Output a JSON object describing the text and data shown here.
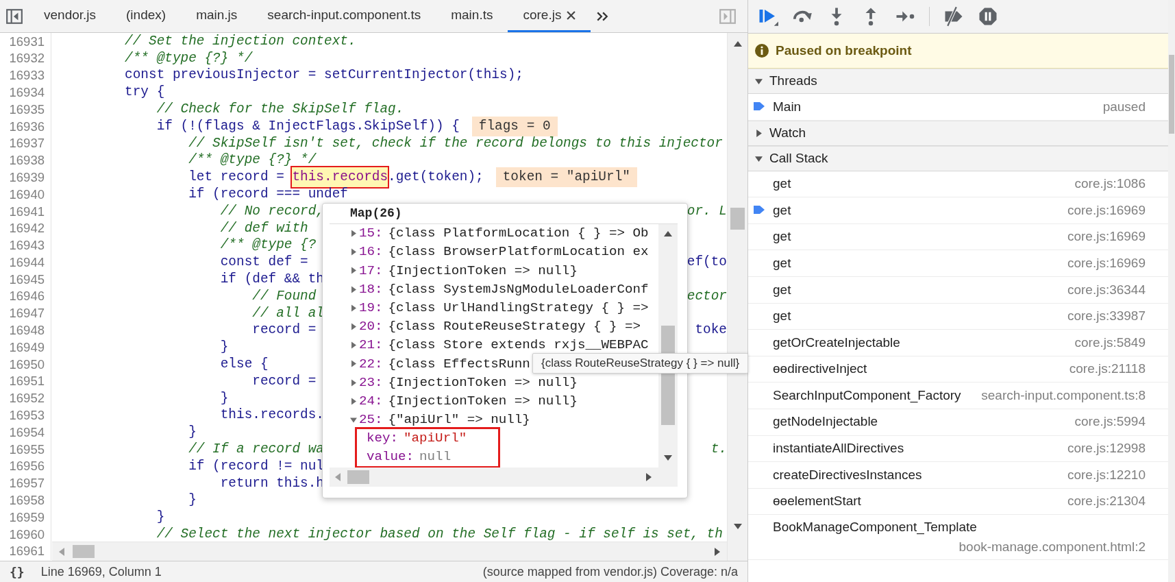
{
  "editor_tabs": [
    {
      "label": "vendor.js",
      "selected": false,
      "closable": false
    },
    {
      "label": "(index)",
      "selected": false,
      "closable": false
    },
    {
      "label": "main.js",
      "selected": false,
      "closable": false
    },
    {
      "label": "search-input.component.ts",
      "selected": false,
      "closable": false
    },
    {
      "label": "main.ts",
      "selected": false,
      "closable": false
    },
    {
      "label": "core.js",
      "selected": true,
      "closable": true
    }
  ],
  "code": {
    "lines": [
      {
        "number": "16931",
        "kind": "comment",
        "text": "        // Set the injection context."
      },
      {
        "number": "16932",
        "kind": "comment",
        "text": "        /** @type {?} */"
      },
      {
        "number": "16933",
        "kind": "code",
        "text": "        const previousInjector = setCurrentInjector(this);"
      },
      {
        "number": "16934",
        "kind": "code",
        "text": "        try {"
      },
      {
        "number": "16935",
        "kind": "comment",
        "text": "            // Check for the SkipSelf flag."
      },
      {
        "number": "16936",
        "kind": "code",
        "text": "            if (!(flags & InjectFlags.SkipSelf)) {",
        "value": "flags = 0"
      },
      {
        "number": "16937",
        "kind": "comment",
        "text": "                // SkipSelf isn't set, check if the record belongs to this injector"
      },
      {
        "number": "16938",
        "kind": "comment",
        "text": "                /** @type {?} */"
      },
      {
        "number": "16939",
        "kind": "code",
        "text": "                let record = ",
        "highlight": "this.records",
        "after": ".get(token);",
        "value": "token = \"apiUrl\""
      },
      {
        "number": "16940",
        "kind": "code",
        "text": "                if (record === undef"
      },
      {
        "number": "16941",
        "kind": "comment",
        "text": "                    // No record,",
        "tail": "or. L"
      },
      {
        "number": "16942",
        "kind": "comment",
        "text": "                    // def with"
      },
      {
        "number": "16943",
        "kind": "comment",
        "text": "                    /** @type {?"
      },
      {
        "number": "16944",
        "kind": "code",
        "text": "                    const def =",
        "tail": "ef(to"
      },
      {
        "number": "16945",
        "kind": "code",
        "text": "                    if (def && th"
      },
      {
        "number": "16946",
        "kind": "comment",
        "text": "                        // Found",
        "tail": "ector"
      },
      {
        "number": "16947",
        "kind": "comment",
        "text": "                        // all al"
      },
      {
        "number": "16948",
        "kind": "code",
        "text": "                        record =",
        "tail": "toke"
      },
      {
        "number": "16949",
        "kind": "code",
        "text": "                    }"
      },
      {
        "number": "16950",
        "kind": "code",
        "text": "                    else {"
      },
      {
        "number": "16951",
        "kind": "code",
        "text": "                        record ="
      },
      {
        "number": "16952",
        "kind": "code",
        "text": "                    }"
      },
      {
        "number": "16953",
        "kind": "code",
        "text": "                    this.records."
      },
      {
        "number": "16954",
        "kind": "code",
        "text": "                }"
      },
      {
        "number": "16955",
        "kind": "comment",
        "text": "                // If a record wa",
        "tail": "t."
      },
      {
        "number": "16956",
        "kind": "code",
        "text": "                if (record != nul"
      },
      {
        "number": "16957",
        "kind": "code",
        "text": "                    return this.h"
      },
      {
        "number": "16958",
        "kind": "code",
        "text": "                }"
      },
      {
        "number": "16959",
        "kind": "code",
        "text": "            }"
      },
      {
        "number": "16960",
        "kind": "comment",
        "text": "            // Select the next injector based on the Self flag - if self is set, th"
      },
      {
        "number": "16961",
        "kind": "code"
      }
    ]
  },
  "popup": {
    "title": "Map(26)",
    "entries": [
      {
        "key": "15:",
        "text": "{class PlatformLocation { } => Ob",
        "expanded": false
      },
      {
        "key": "16:",
        "text": "{class BrowserPlatformLocation ex",
        "expanded": false
      },
      {
        "key": "17:",
        "text": "{InjectionToken => null}",
        "expanded": false
      },
      {
        "key": "18:",
        "text": "{class SystemJsNgModuleLoaderConf",
        "expanded": false
      },
      {
        "key": "19:",
        "text": "{class UrlHandlingStrategy { } =>",
        "expanded": false
      },
      {
        "key": "20:",
        "text": "{class RouteReuseStrategy { } =>",
        "expanded": false
      },
      {
        "key": "21:",
        "text": "{class Store extends rxjs__WEBPAC",
        "expanded": false
      },
      {
        "key": "22:",
        "text": "{class EffectsRunn",
        "expanded": false
      },
      {
        "key": "23:",
        "text": "{InjectionToken => null}",
        "expanded": false
      },
      {
        "key": "24:",
        "text": "{InjectionToken => null}",
        "expanded": false
      },
      {
        "key": "25:",
        "text": "{\"apiUrl\" => null}",
        "expanded": true,
        "children": [
          {
            "key": "key:",
            "value": "\"apiUrl\"",
            "kind": "string"
          },
          {
            "key": "value:",
            "value": "null",
            "kind": "null"
          }
        ]
      }
    ]
  },
  "tooltip": {
    "text": "{class RouteReuseStrategy { } => null}"
  },
  "debugger": {
    "paused_message": "Paused on breakpoint",
    "sections": [
      {
        "title": "Threads",
        "expanded": true,
        "items": [
          {
            "name": "Main",
            "location": "paused",
            "current": true
          }
        ]
      },
      {
        "title": "Watch",
        "expanded": false
      },
      {
        "title": "Call Stack",
        "expanded": true,
        "items": [
          {
            "name": "get",
            "location": "core.js:1086",
            "current": false
          },
          {
            "name": "get",
            "location": "core.js:16969",
            "current": true
          },
          {
            "name": "get",
            "location": "core.js:16969",
            "current": false
          },
          {
            "name": "get",
            "location": "core.js:16969",
            "current": false
          },
          {
            "name": "get",
            "location": "core.js:36344",
            "current": false
          },
          {
            "name": "get",
            "location": "core.js:33987",
            "current": false
          },
          {
            "name": "getOrCreateInjectable",
            "location": "core.js:5849",
            "current": false
          },
          {
            "name": "ɵɵdirectiveInject",
            "location": "core.js:21118",
            "current": false
          },
          {
            "name": "SearchInputComponent_Factory",
            "location": "search-input.component.ts:8",
            "current": false
          },
          {
            "name": "getNodeInjectable",
            "location": "core.js:5994",
            "current": false
          },
          {
            "name": "instantiateAllDirectives",
            "location": "core.js:12998",
            "current": false
          },
          {
            "name": "createDirectivesInstances",
            "location": "core.js:12210",
            "current": false
          },
          {
            "name": "ɵɵelementStart",
            "location": "core.js:21304",
            "current": false
          },
          {
            "name": "BookManageComponent_Template",
            "location": "book-manage.component.html:2",
            "current": false
          }
        ]
      }
    ]
  },
  "status_bar": {
    "pretty_print": "{}",
    "position": "Line 16969, Column 1",
    "source": "(source mapped from vendor.js) Coverage: n/a"
  }
}
